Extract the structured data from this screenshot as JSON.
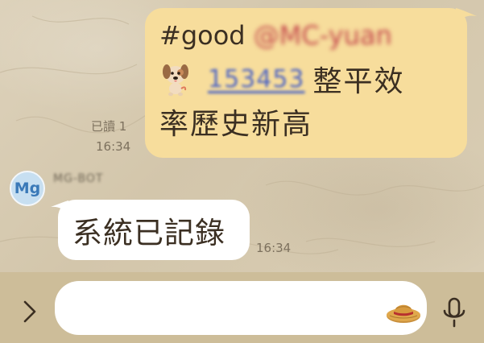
{
  "chat": {
    "outgoing": {
      "hashtag": "#good",
      "mention": "@MC-yuan",
      "number": "153453",
      "line2_text": "整平效",
      "line3_text": "率歷史新高",
      "read_status": "已讀 1",
      "time": "16:34"
    },
    "incoming": {
      "avatar_initials": "Mg",
      "sender": "MG-BOT",
      "message": "系統已記錄",
      "time": "16:34"
    }
  },
  "input": {
    "value": "",
    "placeholder": ""
  },
  "icons": {
    "expand": "chevron-right-icon",
    "sticker": "straw-hat-sticker-icon",
    "mic": "microphone-icon"
  },
  "colors": {
    "outgoing_bubble": "#f7dd9c",
    "incoming_bubble": "#ffffff",
    "mention": "#b0343a",
    "link": "#4a62c4",
    "avatar": "#3a79b8"
  }
}
